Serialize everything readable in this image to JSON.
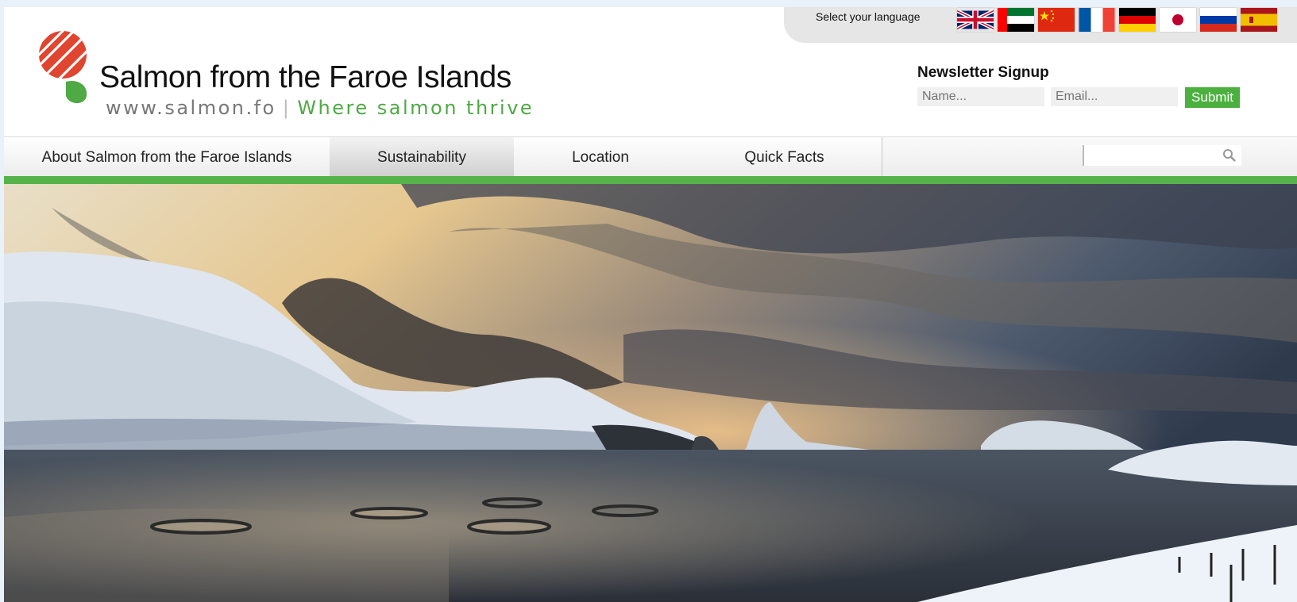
{
  "language_bar": {
    "label": "Select your language",
    "flags": [
      "uk-flag-icon",
      "uae-flag-icon",
      "china-flag-icon",
      "france-flag-icon",
      "germany-flag-icon",
      "japan-flag-icon",
      "russia-flag-icon",
      "spain-flag-icon"
    ]
  },
  "logo": {
    "title": "Salmon from the Faroe Islands",
    "url": "www.salmon.fo",
    "separator": "|",
    "tagline": "Where salmon thrive",
    "colors": {
      "red": "#e0452f",
      "green": "#4fa944"
    }
  },
  "newsletter": {
    "title": "Newsletter Signup",
    "name_placeholder": "Name...",
    "email_placeholder": "Email...",
    "submit_label": "Submit"
  },
  "nav": {
    "tabs": [
      {
        "label": "About Salmon from the Faroe Islands",
        "active": false
      },
      {
        "label": "Sustainability",
        "active": true
      },
      {
        "label": "Location",
        "active": false
      },
      {
        "label": "Quick Facts",
        "active": false
      }
    ],
    "accent_green": "#55b34a",
    "accent_red": "#e23a2a"
  },
  "search": {
    "icon": "search-icon"
  },
  "hero": {
    "image": "faroe-fjord-salmon-farm-photo"
  }
}
